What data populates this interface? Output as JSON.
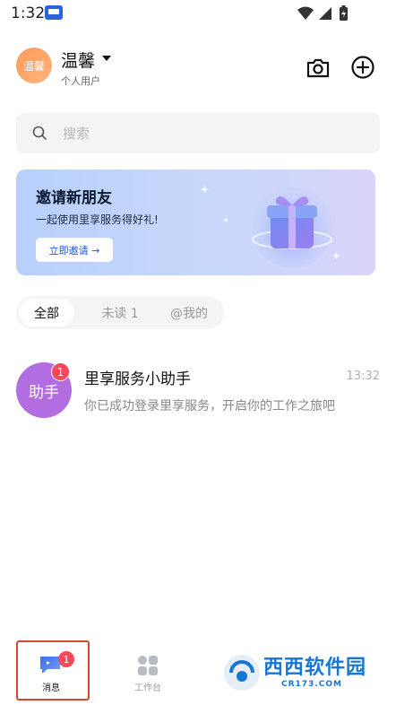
{
  "status_bar": {
    "time": "1:32"
  },
  "header": {
    "avatar_text": "温馨",
    "username": "温馨",
    "user_type": "个人用户"
  },
  "search": {
    "placeholder": "搜索"
  },
  "banner": {
    "title": "邀请新朋友",
    "subtitle": "一起使用里享服务得好礼!",
    "button_label": "立即邀请 →"
  },
  "filter_tabs": [
    {
      "label": "全部",
      "active": true
    },
    {
      "label": "未读 1",
      "active": false
    },
    {
      "label": "@我的",
      "active": false
    }
  ],
  "messages": [
    {
      "avatar_text": "助手",
      "unread": "1",
      "name": "里享服务小助手",
      "time": "13:32",
      "preview": "你已成功登录里享服务，开启你的工作之旅吧"
    }
  ],
  "bottom_nav": {
    "items": [
      {
        "label": "消息",
        "icon": "chat-icon",
        "badge": "1",
        "active": true
      },
      {
        "label": "工作台",
        "icon": "grid-icon",
        "active": false
      }
    ],
    "watermark": {
      "text": "西西软件园",
      "sub": "CR173.COM"
    }
  },
  "colors": {
    "accent": "#2456d6",
    "badge": "#f24a5a",
    "avatar_assistant": "#b26ee0",
    "avatar_user": "#ff9a5a"
  }
}
